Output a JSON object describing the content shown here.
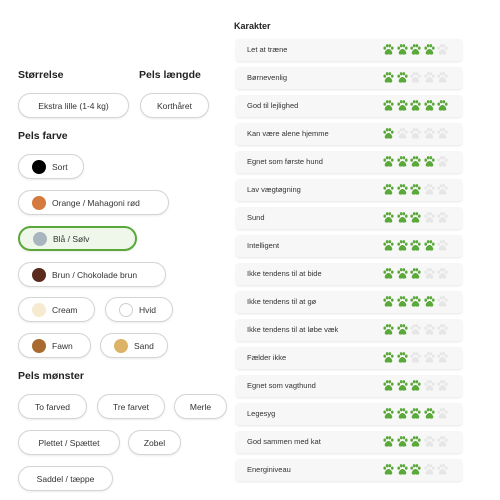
{
  "filters": {
    "size": {
      "title": "Størrelse",
      "selected": "Ekstra lille (1-4 kg)"
    },
    "coat_length": {
      "title": "Pels længde",
      "selected": "Korthåret"
    },
    "coat_color": {
      "title": "Pels farve",
      "options": [
        {
          "label": "Sort",
          "color": "#000000",
          "selected": false
        },
        {
          "label": "Orange / Mahagoni rød",
          "color": "#d57a3e",
          "selected": false
        },
        {
          "label": "Blå / Sølv",
          "color": "#a9b5be",
          "selected": true
        },
        {
          "label": "Brun / Chokolade brun",
          "color": "#5a2a1c",
          "selected": false
        },
        {
          "label": "Cream",
          "color": "#f6ead0",
          "selected": false
        },
        {
          "label": "Hvid",
          "color": "#ffffff",
          "selected": false
        },
        {
          "label": "Fawn",
          "color": "#a86a2e",
          "selected": false
        },
        {
          "label": "Sand",
          "color": "#dcb366",
          "selected": false
        }
      ]
    },
    "coat_pattern": {
      "title": "Pels mønster",
      "options": [
        "To farved",
        "Tre farvet",
        "Merle",
        "Plettet / Spættet",
        "Zobel",
        "Saddel / tæppe"
      ]
    }
  },
  "characteristics": {
    "title": "Karakter",
    "max_rating": 5,
    "paw_icon": "paw-print-icon",
    "active_color": "#5aa83a",
    "inactive_color": "#e6e6e6",
    "items": [
      {
        "label": "Let at træne",
        "rating": 4
      },
      {
        "label": "Børnevenlig",
        "rating": 2
      },
      {
        "label": "God til lejlighed",
        "rating": 5
      },
      {
        "label": "Kan være alene hjemme",
        "rating": 1
      },
      {
        "label": "Egnet som første hund",
        "rating": 4
      },
      {
        "label": "Lav vægtøgning",
        "rating": 3
      },
      {
        "label": "Sund",
        "rating": 3
      },
      {
        "label": "Intelligent",
        "rating": 4
      },
      {
        "label": "Ikke tendens til at bide",
        "rating": 3
      },
      {
        "label": "Ikke tendens til at gø",
        "rating": 4
      },
      {
        "label": "Ikke tendens til at løbe væk",
        "rating": 2
      },
      {
        "label": "Fælder ikke",
        "rating": 2
      },
      {
        "label": "Egnet som vagthund",
        "rating": 3
      },
      {
        "label": "Legesyg",
        "rating": 4
      },
      {
        "label": "God sammen med kat",
        "rating": 3
      },
      {
        "label": "Energiniveau",
        "rating": 3
      }
    ]
  }
}
